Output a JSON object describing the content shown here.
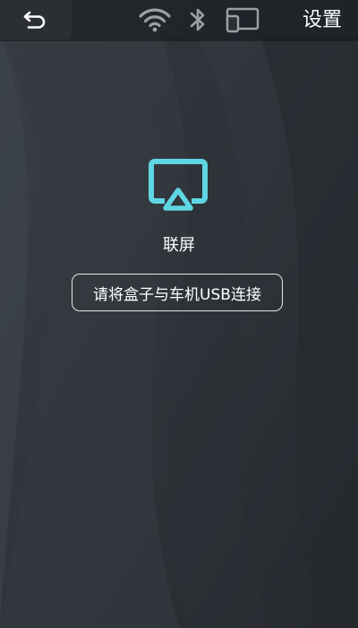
{
  "topbar": {
    "back_icon": "back-arrow-icon",
    "status_icons": [
      "wifi-icon",
      "bluetooth-icon",
      "screen-cast-icon"
    ],
    "settings_label": "设置"
  },
  "main": {
    "icon": "airplay-icon",
    "title": "联屏",
    "hint": "请将盒子与车机USB连接"
  },
  "colors": {
    "accent": "#5fd6e3",
    "background": "#2b3036",
    "topbar": "#2b2f34",
    "status_icon": "#9aa0a6"
  }
}
